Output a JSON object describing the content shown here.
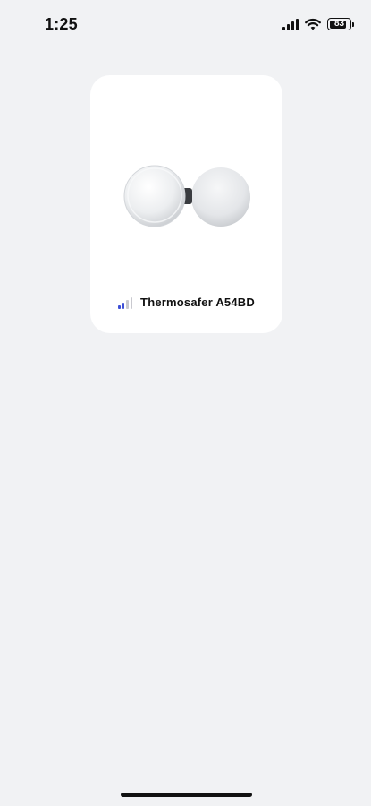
{
  "status_bar": {
    "time": "1:25",
    "battery_level": "83",
    "cellular_icon": "cellular-signal-icon",
    "wifi_icon": "wifi-icon",
    "battery_icon": "battery-icon"
  },
  "devices": [
    {
      "name": "Thermosafer A54BD",
      "image_icon": "thermometer-device-icon",
      "signal_icon": "signal-strength-icon",
      "signal_bars_active": 2,
      "signal_bars_total": 4,
      "signal_active_color": "#3d4fd6",
      "signal_inactive_color": "#c9c9cf"
    }
  ],
  "colors": {
    "background": "#f1f2f4",
    "card": "#ffffff"
  }
}
